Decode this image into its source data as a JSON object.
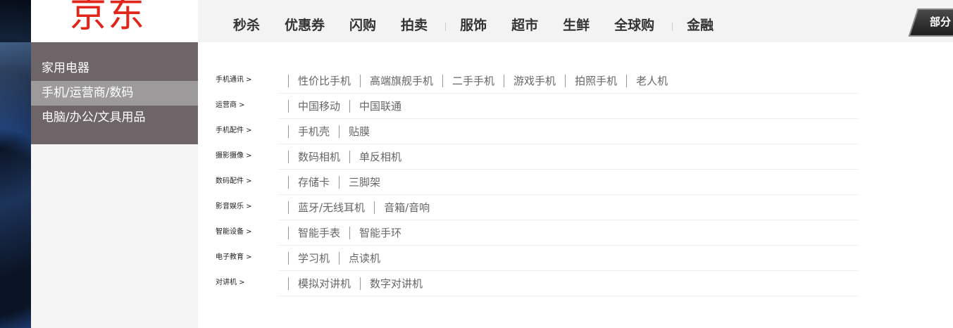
{
  "logo": {
    "text": "京东",
    "color": "#e1251b"
  },
  "nav": {
    "items": [
      "秒杀",
      "优惠券",
      "闪购",
      "拍卖",
      "服饰",
      "超市",
      "生鲜",
      "全球购",
      "金融"
    ]
  },
  "badge": {
    "text": "部分"
  },
  "side_menu": {
    "items": [
      {
        "label": "家用电器",
        "active": false
      },
      {
        "label": "手机/运营商/数码",
        "active": true
      },
      {
        "label": "电脑/办公/文具用品",
        "active": false
      }
    ]
  },
  "categories": [
    {
      "label": "手机通讯 >",
      "links": [
        "性价比手机",
        "高端旗舰手机",
        "二手手机",
        "游戏手机",
        "拍照手机",
        "老人机"
      ]
    },
    {
      "label": "运营商 >",
      "links": [
        "中国移动",
        "中国联通"
      ]
    },
    {
      "label": "手机配件 >",
      "links": [
        "手机壳",
        "贴膜"
      ]
    },
    {
      "label": "摄影摄像 >",
      "links": [
        "数码相机",
        "单反相机"
      ]
    },
    {
      "label": "数码配件 >",
      "links": [
        "存储卡",
        "三脚架"
      ]
    },
    {
      "label": "影音娱乐 >",
      "links": [
        "蓝牙/无线耳机",
        "音箱/音响"
      ]
    },
    {
      "label": "智能设备 >",
      "links": [
        "智能手表",
        "智能手环"
      ]
    },
    {
      "label": "电子教育 >",
      "links": [
        "学习机",
        "点读机"
      ]
    },
    {
      "label": "对讲机 >",
      "links": [
        "模拟对讲机",
        "数字对讲机"
      ]
    }
  ]
}
